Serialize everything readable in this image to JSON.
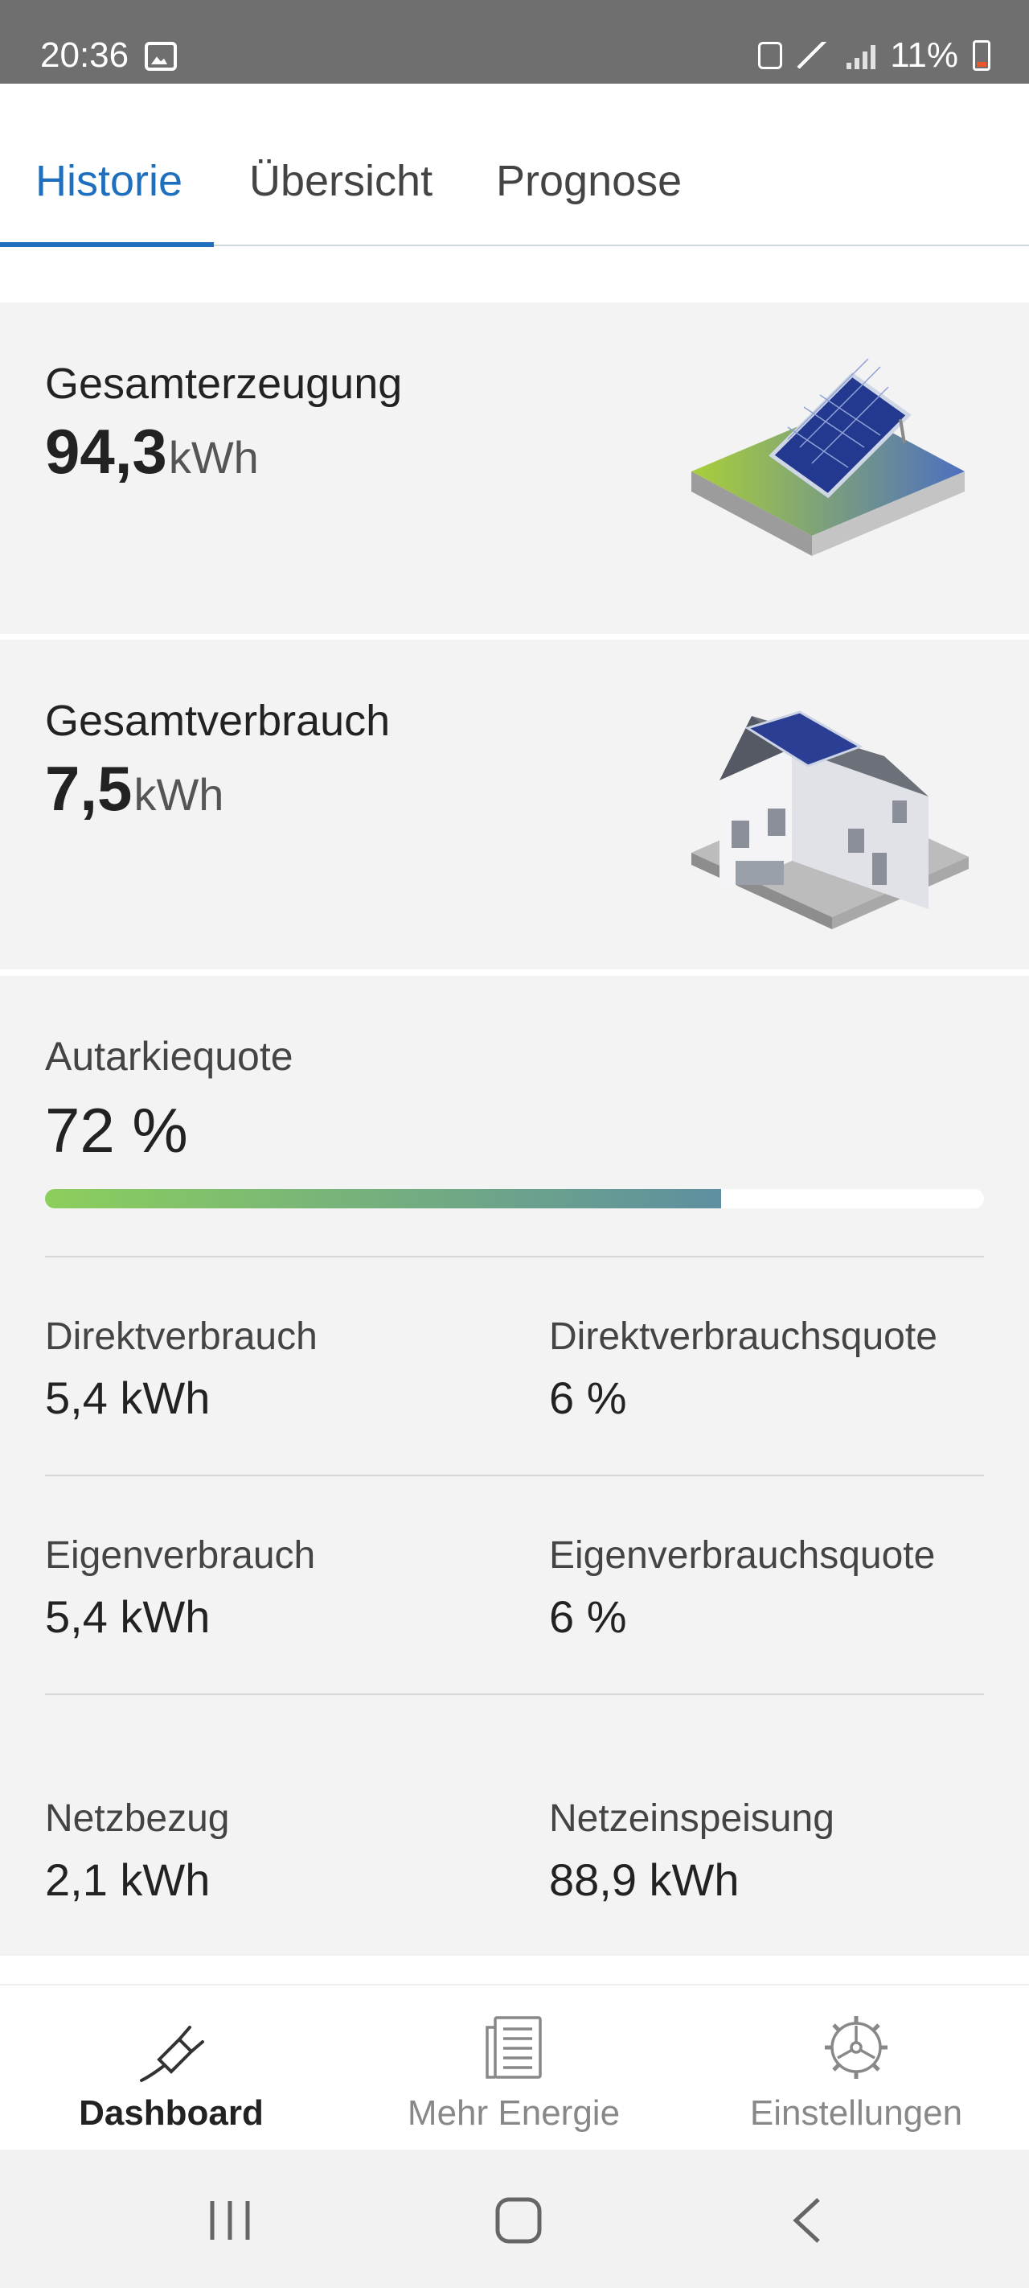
{
  "status_bar": {
    "time": "20:36",
    "battery": "11%"
  },
  "tabs": [
    {
      "label": "Historie",
      "active": true
    },
    {
      "label": "Übersicht",
      "active": false
    },
    {
      "label": "Prognose",
      "active": false
    }
  ],
  "generation": {
    "title": "Gesamterzeugung",
    "value": "94,3",
    "unit": "kWh"
  },
  "consumption": {
    "title": "Gesamtverbrauch",
    "value": "7,5",
    "unit": "kWh"
  },
  "autarky": {
    "label": "Autarkiequote",
    "value": "72 %",
    "fraction": 0.72
  },
  "stats": {
    "direct": {
      "label": "Direktverbrauch",
      "value": "5,4 kWh"
    },
    "direct_rate": {
      "label": "Direktverbrauchsquote",
      "value": "6 %"
    },
    "self": {
      "label": "Eigenverbrauch",
      "value": "5,4 kWh"
    },
    "self_rate": {
      "label": "Eigenverbrauchsquote",
      "value": "6 %"
    },
    "grid_draw": {
      "label": "Netzbezug",
      "value": "2,1 kWh"
    },
    "grid_feed": {
      "label": "Netzeinspeisung",
      "value": "88,9 kWh"
    }
  },
  "bottom_nav": [
    {
      "label": "Dashboard",
      "icon": "plug-icon",
      "active": true
    },
    {
      "label": "Mehr Energie",
      "icon": "newspaper-icon",
      "active": false
    },
    {
      "label": "Einstellungen",
      "icon": "gear-icon",
      "active": false
    }
  ],
  "colors": {
    "accent": "#1f6fbf",
    "progress_start": "#8ccf5c",
    "progress_end": "#5e8fa0"
  }
}
